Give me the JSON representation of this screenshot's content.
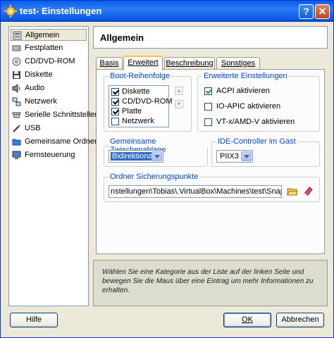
{
  "window": {
    "title": "test- Einstellungen",
    "help_glyph": "?",
    "close_glyph": "✕"
  },
  "sidebar": {
    "items": [
      {
        "label": "Allgemein",
        "icon": "gear-icon",
        "selected": true
      },
      {
        "label": "Festplatten",
        "icon": "hard-disk-icon"
      },
      {
        "label": "CD/DVD-ROM",
        "icon": "cd-icon"
      },
      {
        "label": "Diskette",
        "icon": "floppy-icon"
      },
      {
        "label": "Audio",
        "icon": "speaker-icon"
      },
      {
        "label": "Netzwerk",
        "icon": "network-icon"
      },
      {
        "label": "Serielle Schnittstellen",
        "icon": "serial-port-icon"
      },
      {
        "label": "USB",
        "icon": "usb-icon"
      },
      {
        "label": "Gemeinsame Ordner",
        "icon": "folder-icon"
      },
      {
        "label": "Fernsteuerung",
        "icon": "remote-display-icon"
      }
    ]
  },
  "header": {
    "title": "Allgemein"
  },
  "tabs": [
    {
      "label": "Basis",
      "active": false
    },
    {
      "label": "Erweitert",
      "active": true
    },
    {
      "label": "Beschreibung",
      "active": false
    },
    {
      "label": "Sonstiges",
      "active": false
    }
  ],
  "boot_order": {
    "legend": "Boot-Reihenfolge",
    "items": [
      {
        "label": "Diskette",
        "checked": true
      },
      {
        "label": "CD/DVD-ROM",
        "checked": true
      },
      {
        "label": "Platte",
        "checked": true
      },
      {
        "label": "Netzwerk",
        "checked": false
      }
    ]
  },
  "advanced": {
    "legend": "Erweiterte Einstellungen",
    "options": [
      {
        "label": "ACPI aktivieren",
        "checked": true
      },
      {
        "label": "IO-APIC aktivieren",
        "checked": false
      },
      {
        "label": "VT-x/AMD-V aktivieren",
        "checked": false
      }
    ]
  },
  "clipboard": {
    "legend": "Gemeinsame Zwischenablage",
    "value": "Bidirektional"
  },
  "ide": {
    "legend": "IDE-Controller im Gast",
    "value": "PIIX3"
  },
  "snapshots": {
    "legend": "Ordner Sicherungspunkte",
    "path": "nstellungen\\Tobias\\.VirtualBox\\Machines\\test\\Snapshots"
  },
  "info_text": "Wählen Sie eine Kategorie aus der Liste auf der linken Seite und bewegen Sie die Maus über eine Eintrag um mehr Informationen zu erhalten.",
  "buttons": {
    "help": "Hilfe",
    "ok": "OK",
    "cancel": "Abbrechen"
  },
  "colors": {
    "accent": "#0a5ee8",
    "legend": "#0046d5",
    "tab_highlight": "#ffc83c"
  }
}
